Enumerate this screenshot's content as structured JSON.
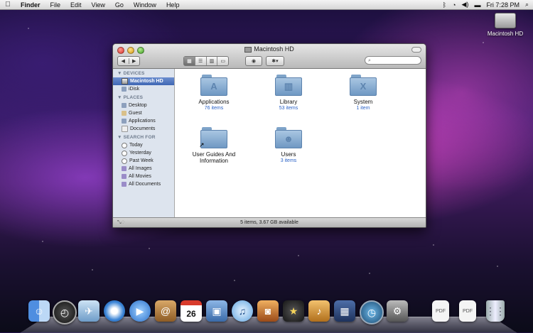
{
  "menubar": {
    "apple_icon": "apple-logo-icon",
    "app_name": "Finder",
    "menus": [
      "File",
      "Edit",
      "View",
      "Go",
      "Window",
      "Help"
    ],
    "clock": "Fri 7:28 PM"
  },
  "desktop": {
    "hd_label": "Macintosh HD"
  },
  "window": {
    "title": "Macintosh HD",
    "nav_back": "◀",
    "nav_forward": "▶",
    "view_modes": [
      "icon-view",
      "list-view",
      "column-view",
      "coverflow-view"
    ],
    "search_placeholder": "",
    "status": "5 items, 3.67 GB available"
  },
  "sidebar": {
    "devices_heading": "DEVICES",
    "devices": [
      "Macintosh HD",
      "iDisk"
    ],
    "places_heading": "PLACES",
    "places": [
      "Desktop",
      "Guest",
      "Applications",
      "Documents"
    ],
    "search_heading": "SEARCH FOR",
    "search_for": [
      "Today",
      "Yesterday",
      "Past Week",
      "All Images",
      "All Movies",
      "All Documents"
    ]
  },
  "items": [
    {
      "name": "Applications",
      "count": "76 items",
      "glyph": "A"
    },
    {
      "name": "Library",
      "count": "53 items",
      "glyph": "▥"
    },
    {
      "name": "System",
      "count": "1 item",
      "glyph": "X"
    },
    {
      "name": "User Guides And Information",
      "count": "",
      "glyph": ""
    },
    {
      "name": "Users",
      "count": "3 items",
      "glyph": "☻"
    }
  ],
  "dock": {
    "apps": [
      "Finder",
      "Dashboard",
      "Mail",
      "Safari",
      "iChat",
      "Address Book",
      "iCal",
      "Preview",
      "iTunes",
      "iPhoto",
      "iMovie",
      "GarageBand",
      "Spaces",
      "Time Machine",
      "System Preferences",
      "PDF",
      "PDF",
      "Trash"
    ],
    "ical_date": "26"
  }
}
